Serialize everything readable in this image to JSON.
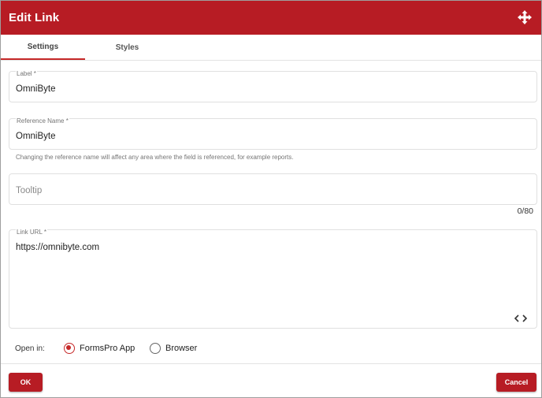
{
  "dialog": {
    "title": "Edit Link",
    "move_icon": "move-arrows-icon"
  },
  "tabs": [
    {
      "label": "Settings",
      "active": true
    },
    {
      "label": "Styles",
      "active": false
    }
  ],
  "fields": {
    "label": {
      "label": "Label *",
      "value": "OmniByte"
    },
    "reference_name": {
      "label": "Reference Name *",
      "value": "OmniByte",
      "helper": "Changing the reference name will affect any area where the field is referenced, for example reports."
    },
    "tooltip": {
      "placeholder": "Tooltip",
      "value": "",
      "counter": "0/80"
    },
    "link_url": {
      "label": "Link URL *",
      "value": "https://omnibyte.com",
      "code_icon": "code-brackets-icon"
    }
  },
  "open_in": {
    "label": "Open in:",
    "options": [
      {
        "label": "FormsPro App",
        "selected": true
      },
      {
        "label": "Browser",
        "selected": false
      }
    ]
  },
  "footer": {
    "ok_label": "OK",
    "cancel_label": "Cancel"
  },
  "colors": {
    "accent": "#b71c24",
    "radio_selected": "#c62828"
  }
}
